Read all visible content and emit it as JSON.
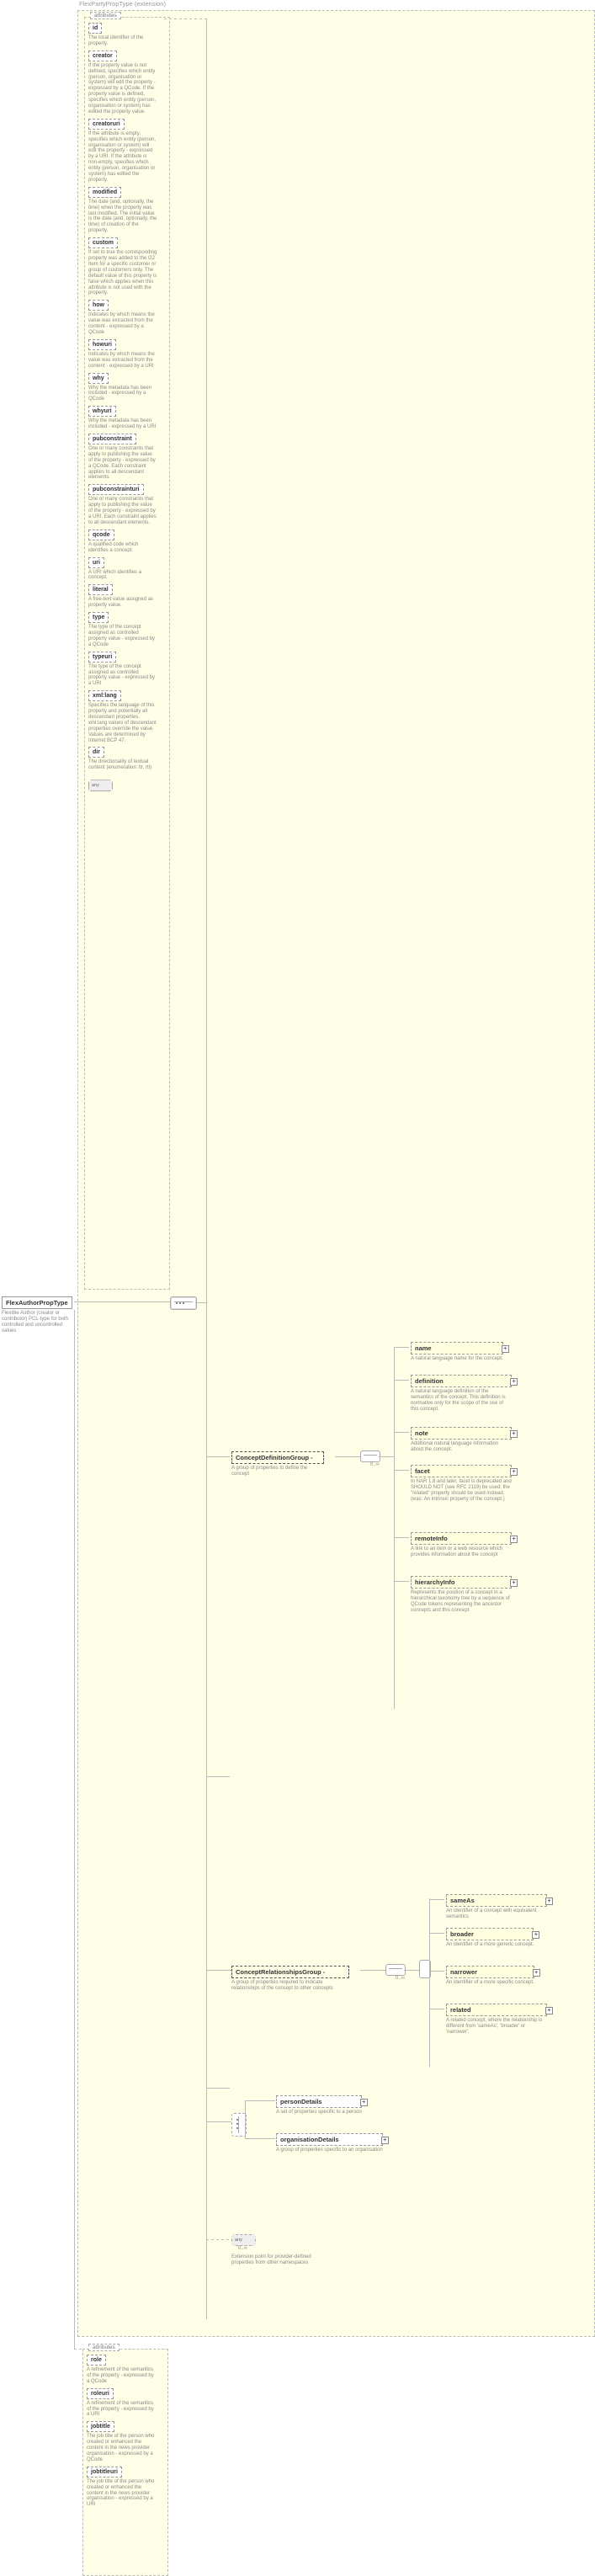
{
  "extension_label": "FlexPartyPropType (extension)",
  "root": {
    "name": "FlexAuthorPropType",
    "desc": "Flexible Author (creator or contributor) PCL-type for both controlled and uncontrolled values"
  },
  "attr1_title": "attributes",
  "attrs1": [
    {
      "name": "id",
      "desc": "The local identifier of the property."
    },
    {
      "name": "creator",
      "desc": "If the property value is not defined, specifies which entity (person, organisation or system) will edit the property - expressed by a QCode. If the property value is defined, specifies which entity (person, organisation or system) has edited the property value."
    },
    {
      "name": "creatoruri",
      "desc": "If the attribute is empty, specifies which entity (person, organisation or system) will edit the property - expressed by a URI. If the attribute is non-empty, specifies which entity (person, organisation or system) has edited the property."
    },
    {
      "name": "modified",
      "desc": "The date (and, optionally, the time) when the property was last modified. The initial value is the date (and, optionally, the time) of creation of the property."
    },
    {
      "name": "custom",
      "desc": "If set to true the corresponding property was added to the G2 Item for a specific customer or group of customers only. The default value of this property is false which applies when this attribute is not used with the property."
    },
    {
      "name": "how",
      "desc": "Indicates by which means the value was extracted from the content - expressed by a QCode"
    },
    {
      "name": "howuri",
      "desc": "Indicates by which means the value was extracted from the content - expressed by a URI"
    },
    {
      "name": "why",
      "desc": "Why the metadata has been included - expressed by a QCode"
    },
    {
      "name": "whyuri",
      "desc": "Why the metadata has been included - expressed by a URI"
    },
    {
      "name": "pubconstraint",
      "desc": "One or many constraints that apply to publishing the value of the property - expressed by a QCode. Each constraint applies to all descendant elements."
    },
    {
      "name": "pubconstrainturi",
      "desc": "One or many constraints that apply to publishing the value of the property - expressed by a URI. Each constraint applies to all descendant elements."
    },
    {
      "name": "qcode",
      "desc": "A qualified code which identifies a concept."
    },
    {
      "name": "uri",
      "desc": "A URI which identifies a concept."
    },
    {
      "name": "literal",
      "desc": "A free-text value assigned as property value."
    },
    {
      "name": "type",
      "desc": "The type of the concept assigned as controlled property value - expressed by a QCode"
    },
    {
      "name": "typeuri",
      "desc": "The type of the concept assigned as controlled property value - expressed by a URI"
    },
    {
      "name": "xml:lang",
      "desc": "Specifies the language of this property and potentially all descendant properties. xml:lang values of descendant properties override the value. Values are determined by Internet BCP 47."
    },
    {
      "name": "dir",
      "desc": "The directionality of textual content (enumeration: ltr, rtl)"
    }
  ],
  "attr1_any": "##other",
  "groups": {
    "cdg": {
      "name": "ConceptDefinitionGroup",
      "desc": "A group of properties to define the concept",
      "mult": "0..∞"
    },
    "crg": {
      "name": "ConceptRelationshipsGroup",
      "desc": "A group of properties required to indicate relationships of the concept to other concepts",
      "mult": "0..∞"
    }
  },
  "cdg_children": [
    {
      "name": "name",
      "desc": "A natural language name for the concept."
    },
    {
      "name": "definition",
      "desc": "A natural language definition of the semantics of the concept. This definition is normative only for the scope of the use of this concept."
    },
    {
      "name": "note",
      "desc": "Additional natural language information about the concept."
    },
    {
      "name": "facet",
      "desc": "In NAR 1.8 and later, facet is deprecated and SHOULD NOT (see RFC 2119) be used; the \"related\" property should be used instead. (was: An intrinsic property of the concept.)"
    },
    {
      "name": "remoteInfo",
      "desc": "A link to an item or a web resource which provides information about the concept"
    },
    {
      "name": "hierarchyInfo",
      "desc": "Represents the position of a concept in a hierarchical taxonomy tree by a sequence of QCode tokens representing the ancestor concepts and this concept"
    }
  ],
  "crg_children": [
    {
      "name": "sameAs",
      "desc": "An identifier of a concept with equivalent semantics"
    },
    {
      "name": "broader",
      "desc": "An identifier of a more generic concept."
    },
    {
      "name": "narrower",
      "desc": "An identifier of a more specific concept."
    },
    {
      "name": "related",
      "desc": "A related concept, where the relationship is different from 'sameAs', 'broader' or 'narrower'."
    }
  ],
  "choice": {
    "person": {
      "name": "personDetails",
      "desc": "A set of properties specific to a person"
    },
    "org": {
      "name": "organisationDetails",
      "desc": "A group of properties specific to an organisation"
    }
  },
  "bottom_any": {
    "label": "##other",
    "mult": "0..∞",
    "desc": "Extension point for provider-defined properties from other namespaces"
  },
  "attr2_title": "attributes",
  "attrs2": [
    {
      "name": "role",
      "desc": "A refinement of the semantics of the property - expressed by a QCode"
    },
    {
      "name": "roleuri",
      "desc": "A refinement of the semantics of the property - expressed by a URI"
    },
    {
      "name": "jobtitle",
      "desc": "The job title of the person who created or enhanced the content in the news provider organisation - expressed by a QCode"
    },
    {
      "name": "jobtitleuri",
      "desc": "The job title of the person who created or enhanced the content in the news provider organisation - expressed by a URI"
    }
  ]
}
